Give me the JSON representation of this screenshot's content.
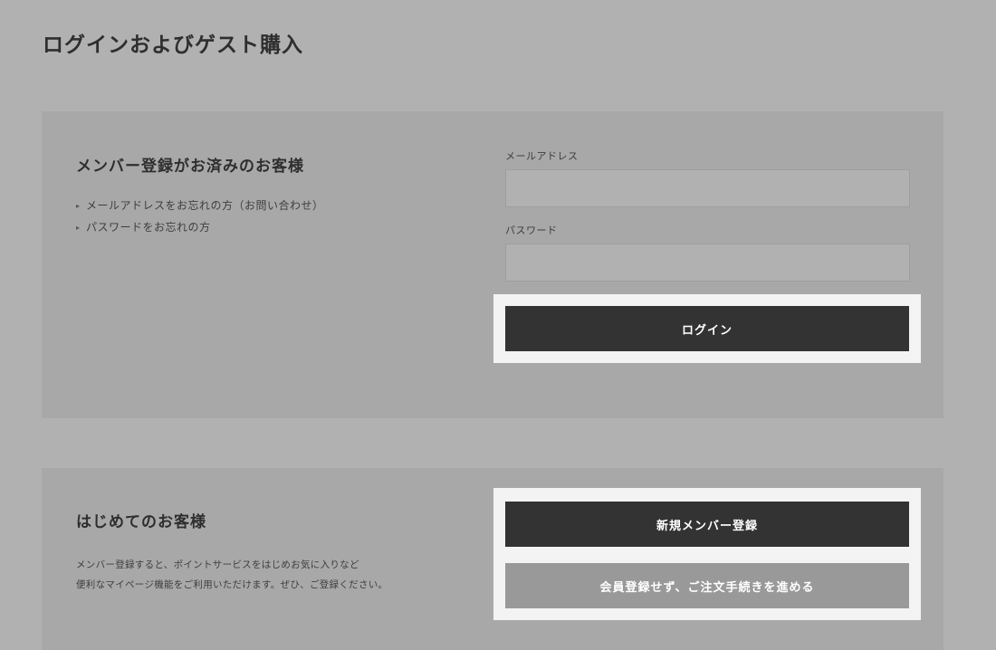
{
  "page": {
    "title": "ログインおよびゲスト購入"
  },
  "member_login": {
    "heading": "メンバー登録がお済みのお客様",
    "help_links": [
      {
        "label": "メールアドレスをお忘れの方（お問い合わせ）"
      },
      {
        "label": "パスワードをお忘れの方"
      }
    ],
    "email": {
      "label": "メールアドレス",
      "value": "",
      "placeholder": ""
    },
    "password": {
      "label": "パスワード",
      "value": "",
      "placeholder": ""
    },
    "login_button": "ログイン"
  },
  "first_time": {
    "heading": "はじめてのお客様",
    "description_lines": [
      "メンバー登録すると、ポイントサービスをはじめお気に入りなど",
      "便利なマイページ機能をご利用いただけます。ぜひ、ご登録ください。"
    ],
    "register_button": "新規メンバー登録",
    "guest_button": "会員登録せず、ご注文手続きを進める"
  },
  "colors": {
    "background": "#b1b1b1",
    "panel": "#a8a8a8",
    "highlight": "#f3f3f3",
    "primary_button": "#333333",
    "secondary_button": "#999999"
  }
}
